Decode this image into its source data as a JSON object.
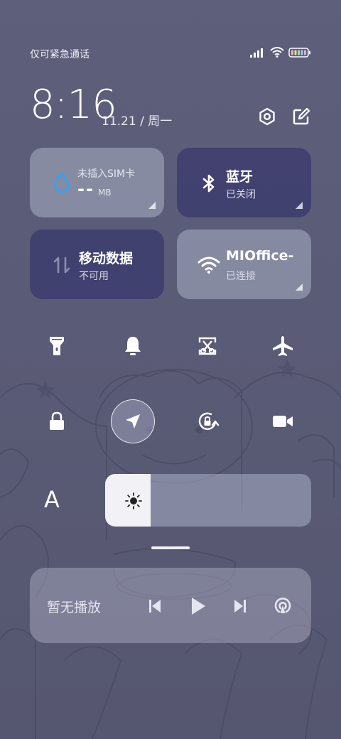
{
  "status_bar": {
    "carrier_text": "仅可紧急通话",
    "signal_icon": "signal-icon",
    "wifi_icon": "wifi-icon",
    "battery_icon": "battery-icon"
  },
  "header": {
    "time": "8:16",
    "date": "11.21 / 周一",
    "settings_icon": "settings-icon",
    "edit_icon": "edit-icon"
  },
  "tiles": [
    {
      "name": "sim-data",
      "title": "未插入SIM卡",
      "value": "--",
      "unit": "MB",
      "icon": "water-drop-icon",
      "state": "off"
    },
    {
      "name": "bluetooth",
      "title": "蓝牙",
      "subtitle": "已关闭",
      "icon": "bluetooth-icon",
      "state": "off"
    },
    {
      "name": "mobile-data",
      "title": "移动数据",
      "subtitle": "不可用",
      "icon": "data-arrows-icon",
      "state": "unavailable"
    },
    {
      "name": "wifi",
      "title": "MIOffice-",
      "subtitle": "已连接",
      "icon": "wifi-icon",
      "state": "on"
    }
  ],
  "quick_toggles": [
    {
      "name": "flashlight-toggle",
      "icon": "flashlight-icon"
    },
    {
      "name": "sound-toggle",
      "icon": "bell-icon"
    },
    {
      "name": "screenshot-toggle",
      "icon": "screenshot-icon"
    },
    {
      "name": "airplane-toggle",
      "icon": "airplane-icon"
    },
    {
      "name": "lock-screen-toggle",
      "icon": "lock-icon"
    },
    {
      "name": "location-toggle",
      "icon": "location-arrow-icon",
      "active": true
    },
    {
      "name": "rotation-lock-toggle",
      "icon": "rotation-lock-icon"
    },
    {
      "name": "screen-record-toggle",
      "icon": "video-camera-icon"
    }
  ],
  "brightness": {
    "auto_label": "A",
    "icon": "sun-icon",
    "level_fraction": 0.22
  },
  "media": {
    "label": "暂无播放",
    "prev_icon": "previous-icon",
    "play_icon": "play-icon",
    "next_icon": "next-icon",
    "cast_icon": "cast-icon"
  },
  "colors": {
    "background": "#5b5c78",
    "tile_active": "#403f70",
    "tile_light": "#a0a4bc",
    "accent_blue": "#3aa0f0"
  }
}
